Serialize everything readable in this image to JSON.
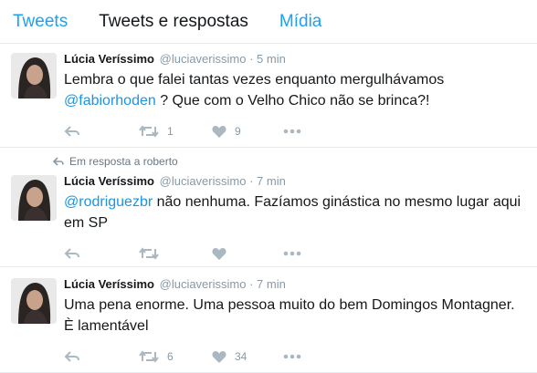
{
  "tabs": [
    {
      "label": "Tweets"
    },
    {
      "label": "Tweets e respostas"
    },
    {
      "label": "Mídia"
    }
  ],
  "colors": {
    "link": "#1b95e0",
    "icon": "#aab8c2",
    "muted": "#8899a6"
  },
  "tweets": [
    {
      "name": "Lúcia Veríssimo",
      "handle": "@luciaverissimo",
      "dot": "·",
      "time": "5 min",
      "text_line1": "Lembra o que falei tantas vezes enquanto mergulhávamos",
      "mention": "@fabiorhoden",
      "text_rest": " ? Que com o Velho Chico não se brinca?!",
      "retweets": "1",
      "likes": "9"
    },
    {
      "reply_context": "Em resposta a roberto",
      "name": "Lúcia Veríssimo",
      "handle": "@luciaverissimo",
      "dot": "·",
      "time": "7 min",
      "mention": "@rodriguezbr",
      "text_rest": " não nenhuma. Fazíamos ginástica no mesmo lugar aqui em SP",
      "retweets": "",
      "likes": ""
    },
    {
      "name": "Lúcia Veríssimo",
      "handle": "@luciaverissimo",
      "dot": "·",
      "time": "7 min",
      "text": "Uma pena enorme. Uma pessoa muito do bem Domingos Montagner. È lamentável",
      "retweets": "6",
      "likes": "34"
    }
  ]
}
